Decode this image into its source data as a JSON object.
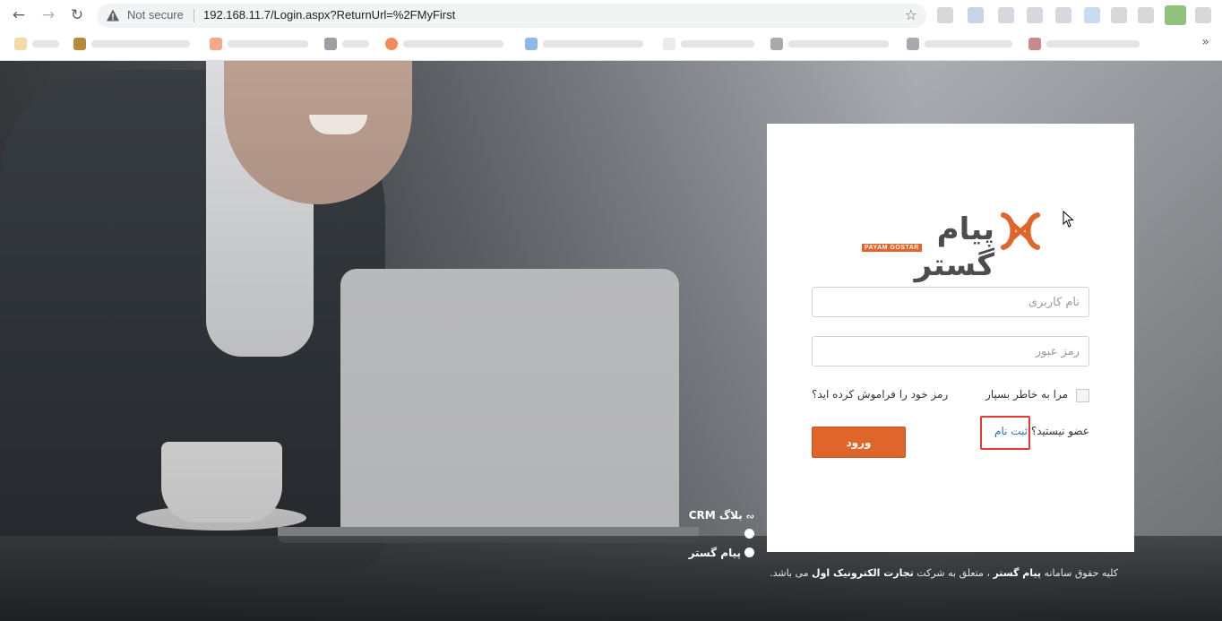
{
  "browser": {
    "security_label": "Not secure",
    "url": "192.168.11.7/Login.aspx?ReturnUrl=%2FMyFirst",
    "icons": [
      "back-icon",
      "forward-icon",
      "reload-icon",
      "warning-icon",
      "star-icon",
      "more-bookmarks-icon"
    ],
    "more_bookmarks": "»"
  },
  "login": {
    "logo_text": "پیام گستر",
    "logo_subtext": "PAYAM GOSTAR",
    "username_placeholder": "نام کاربری",
    "password_placeholder": "رمز عبور",
    "remember_label": "مرا به خاطر بسپار",
    "forgot_label": "رمز خود را فراموش کرده اید؟",
    "not_member_label": "عضو نیستید؟",
    "register_label": "ثبت نام",
    "submit_label": "ورود"
  },
  "footer": {
    "links": [
      "بلاگ CRM",
      "",
      "پیام گستر"
    ],
    "copyright_prefix": "کلیه حقوق سامانه",
    "copyright_brand": "پیام گستر",
    "copyright_mid": "، متعلق به شرکت",
    "copyright_company": "تجارت الکترونیک اول",
    "copyright_suffix": "می باشد."
  },
  "colors": {
    "accent": "#e0652a",
    "link": "#2a6ebb",
    "highlight_box": "#e53935"
  }
}
